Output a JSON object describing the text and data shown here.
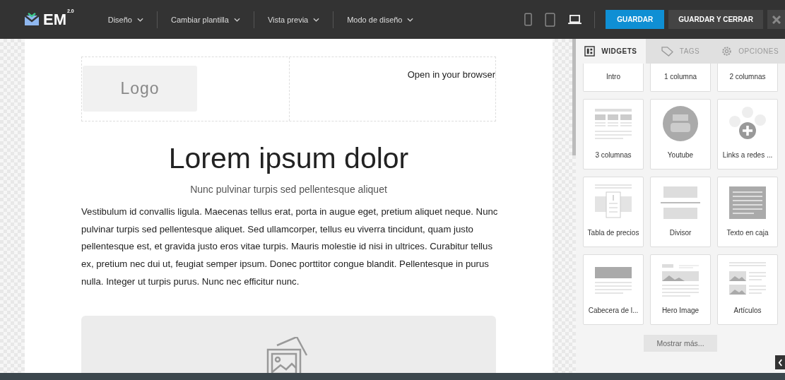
{
  "app": {
    "logo": "EM",
    "version": "2.0"
  },
  "menus": [
    {
      "label": "Diseño"
    },
    {
      "label": "Cambiar plantilla"
    },
    {
      "label": "Vista previa"
    },
    {
      "label": "Modo de diseño"
    }
  ],
  "devices": [
    {
      "kind": "phone",
      "selected": false
    },
    {
      "kind": "tablet",
      "selected": false
    },
    {
      "kind": "laptop",
      "selected": true
    }
  ],
  "buttons": {
    "save": "GUARDAR",
    "save_close": "GUARDAR Y CERRAR"
  },
  "email": {
    "logo": "Logo",
    "browser_link": "Open in your browser",
    "title": "Lorem ipsum dolor",
    "subtitle": "Nunc pulvinar turpis sed pellentesque aliquet",
    "body": "Vestibulum id convallis ligula. Maecenas tellus erat, porta in augue eget, pretium aliquet neque. Nunc pulvinar turpis sed pellentesque aliquet. Sed ullamcorper, tellus eu viverra tincidunt, quam justo pellentesque est, et gravida justo eros vitae turpis. Mauris molestie id nisi in ultrices. Curabitur tellus ex, pretium nec dui ut, feugiat semper ipsum. Donec porttitor congue blandit. Pellentesque in purus nulla. Integer ut turpis purus. Nunc nec efficitur nunc."
  },
  "sidebar": {
    "tabs": [
      {
        "label": "WIDGETS",
        "kind": "widgets",
        "selected": true
      },
      {
        "label": "TAGS",
        "kind": "tags",
        "selected": false
      },
      {
        "label": "OPCIONES",
        "kind": "options",
        "selected": false
      }
    ],
    "widgets": [
      {
        "label": "Intro",
        "kind": "cut"
      },
      {
        "label": "1 columna",
        "kind": "cut"
      },
      {
        "label": "2 columnas",
        "kind": "cut"
      },
      {
        "label": "3 columnas",
        "kind": "three-columns"
      },
      {
        "label": "Youtube",
        "kind": "video"
      },
      {
        "label": "Links a redes ...",
        "kind": "social"
      },
      {
        "label": "Tabla de precios",
        "kind": "pricing"
      },
      {
        "label": "Divisor",
        "kind": "divider"
      },
      {
        "label": "Texto en caja",
        "kind": "textbox"
      },
      {
        "label": "Cabecera de l...",
        "kind": "header"
      },
      {
        "label": "Hero Image",
        "kind": "hero"
      },
      {
        "label": "Artículos",
        "kind": "articles"
      }
    ],
    "more": "Mostrar más..."
  }
}
